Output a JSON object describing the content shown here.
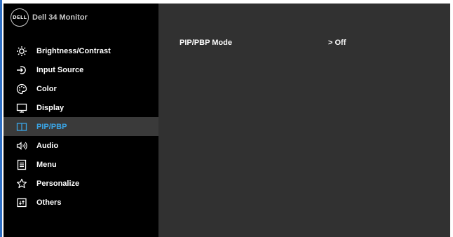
{
  "header": {
    "logo_text": "DELL",
    "title": "Dell 34 Monitor"
  },
  "menu": {
    "items": [
      {
        "label": "Brightness/Contrast",
        "icon": "brightness-icon"
      },
      {
        "label": "Input Source",
        "icon": "input-source-icon"
      },
      {
        "label": "Color",
        "icon": "color-palette-icon"
      },
      {
        "label": "Display",
        "icon": "display-icon"
      },
      {
        "label": "PIP/PBP",
        "icon": "pip-pbp-icon",
        "selected": true
      },
      {
        "label": "Audio",
        "icon": "audio-icon"
      },
      {
        "label": "Menu",
        "icon": "menu-icon"
      },
      {
        "label": "Personalize",
        "icon": "star-icon"
      },
      {
        "label": "Others",
        "icon": "others-icon"
      }
    ]
  },
  "content": {
    "setting_label": "PIP/PBP Mode",
    "setting_value": "> Off"
  },
  "colors": {
    "sidebar_bg": "#000000",
    "content_bg": "#313131",
    "selected_bg": "#3a3a3a",
    "accent": "#3aa5e6",
    "frame_line": "#2f6fc4"
  }
}
